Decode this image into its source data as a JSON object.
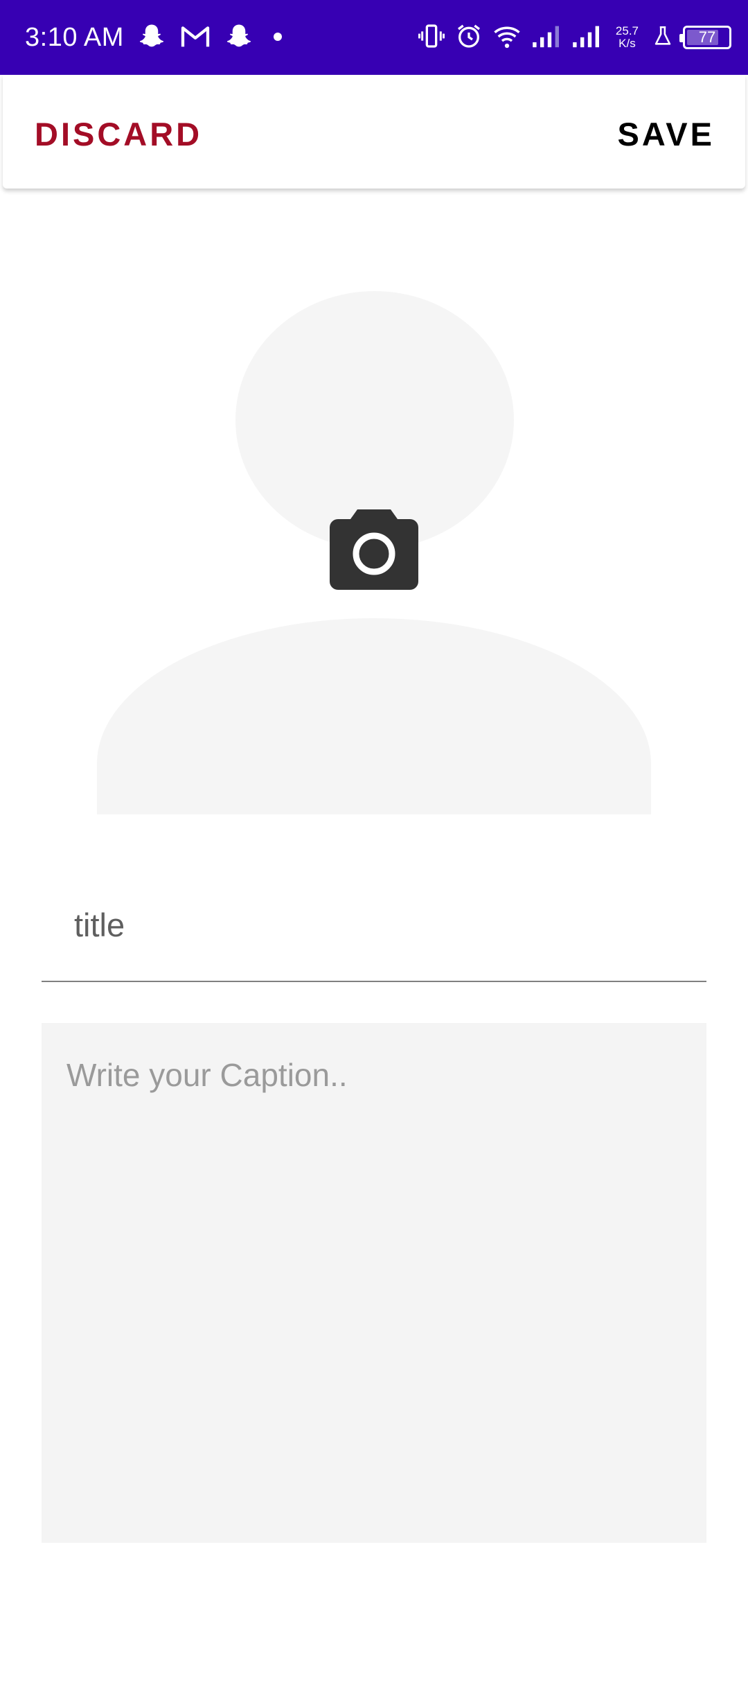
{
  "status_bar": {
    "time": "3:10 AM",
    "net_speed_value": "25.7",
    "net_speed_unit": "K/s",
    "battery_level": "77",
    "battery_fraction": 0.77,
    "background_color": "#3700b3",
    "left_icons": [
      "snapchat-icon",
      "gmail-icon",
      "snapchat-icon",
      "notification-dot-icon"
    ],
    "right_icons": [
      "vibrate-icon",
      "alarm-icon",
      "wifi-icon",
      "signal-icon",
      "signal-icon",
      "lab-flask-icon",
      "battery-icon"
    ]
  },
  "toolbar": {
    "discard_label": "DISCARD",
    "save_label": "SAVE",
    "discard_color": "#a30d26"
  },
  "avatar": {
    "icon": "camera-icon"
  },
  "form": {
    "title_value": "title",
    "caption_placeholder": "Write your Caption.."
  }
}
